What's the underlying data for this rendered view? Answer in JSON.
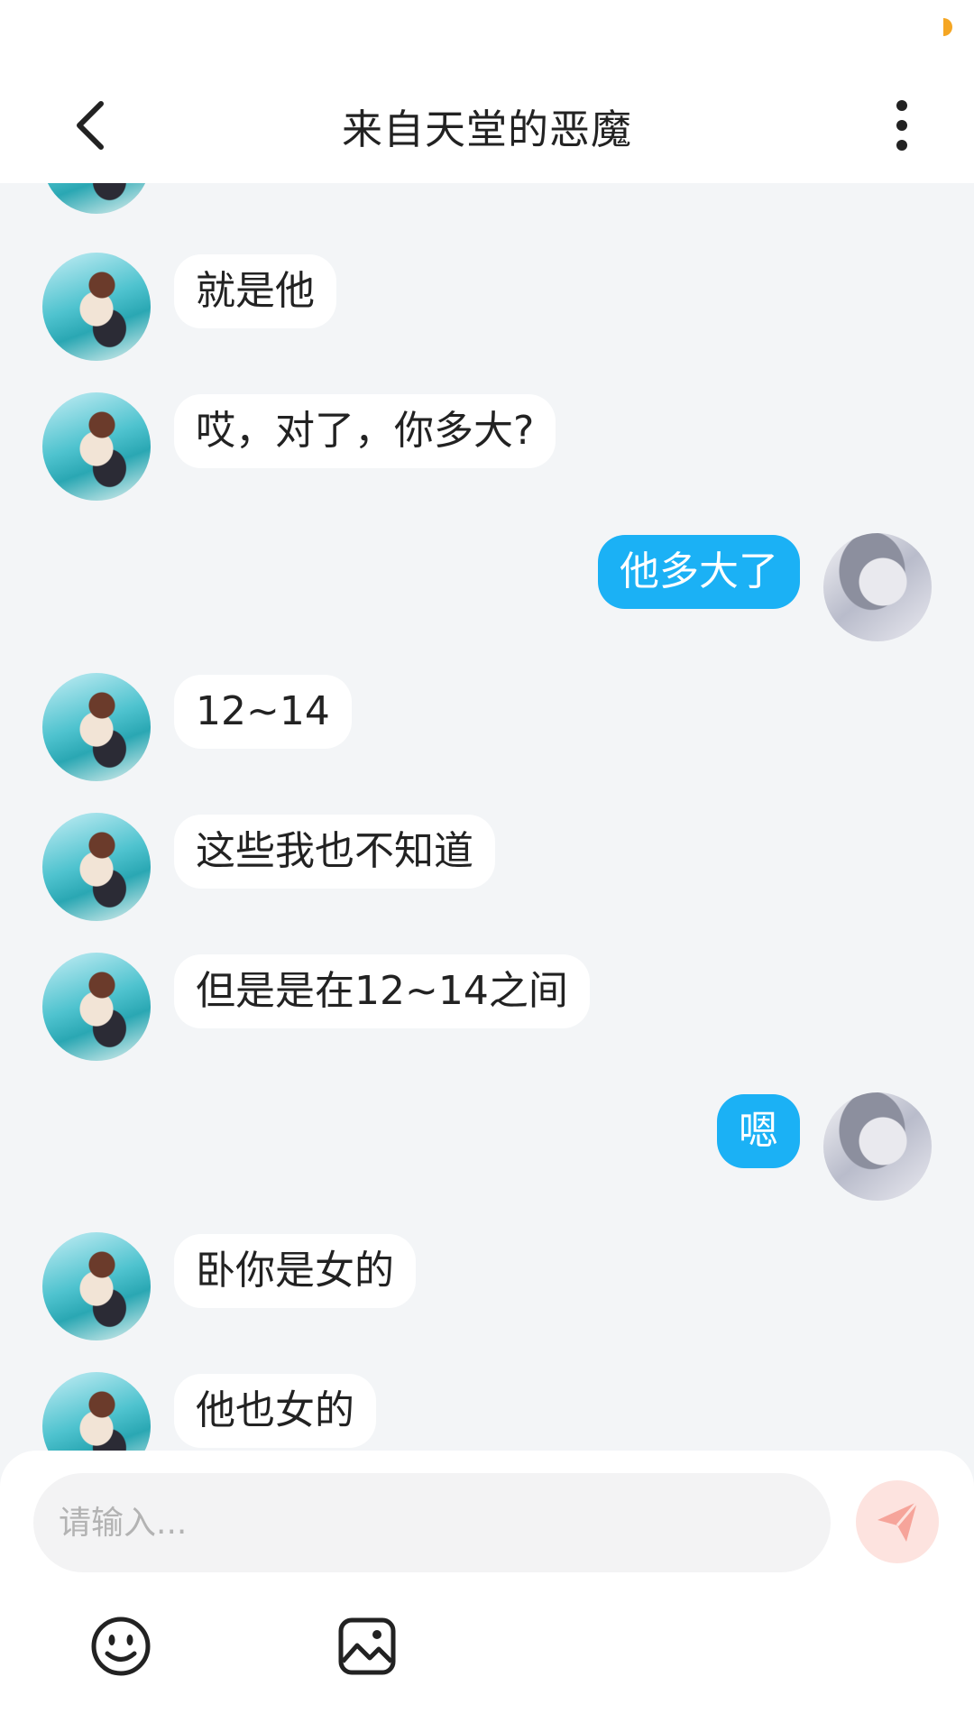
{
  "header": {
    "title": "来自天堂的恶魔",
    "back_icon": "chevron-left-icon",
    "more_icon": "more-vertical-icon"
  },
  "messages": [
    {
      "side": "left",
      "text": "就是他"
    },
    {
      "side": "left",
      "text": "哎，对了，你多大?"
    },
    {
      "side": "right",
      "text": "他多大了"
    },
    {
      "side": "left",
      "text": "12~14"
    },
    {
      "side": "left",
      "text": "这些我也不知道"
    },
    {
      "side": "left",
      "text": "但是是在12~14之间"
    },
    {
      "side": "right",
      "text": "嗯"
    },
    {
      "side": "left",
      "text": "卧你是女的"
    },
    {
      "side": "left",
      "text": "他也女的"
    }
  ],
  "composer": {
    "placeholder": "请输入...",
    "send_icon": "send-icon",
    "emoji_icon": "emoji-icon",
    "image_icon": "image-icon"
  },
  "colors": {
    "background": "#f3f5f7",
    "outgoing_bubble": "#1bb1f5",
    "incoming_bubble": "#ffffff",
    "send_button": "#fde3df",
    "send_arrow": "#f6a49a",
    "status_indicator": "#f5a623"
  }
}
